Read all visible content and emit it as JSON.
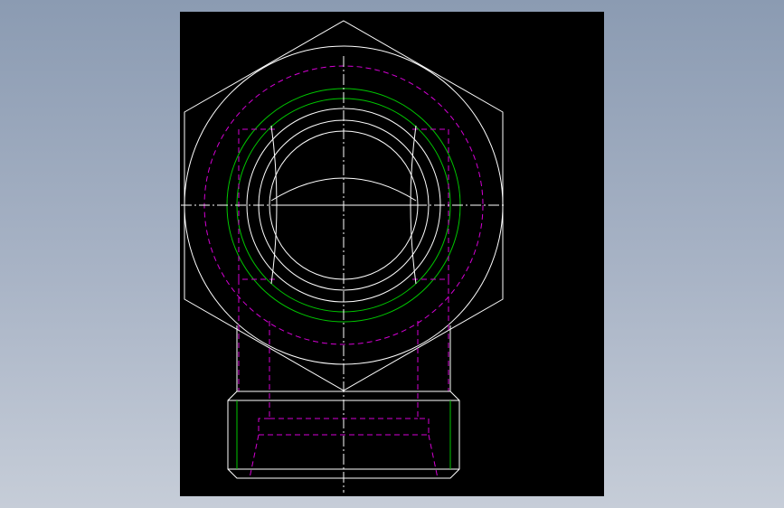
{
  "drawing": {
    "background": "#000000",
    "colors": {
      "outline": "#ffffff",
      "thread": "#00c800",
      "hidden": "#d400d4",
      "center": "#ffffff"
    },
    "views": [
      "hexagon-front-view",
      "pipe-outlet-view"
    ]
  }
}
